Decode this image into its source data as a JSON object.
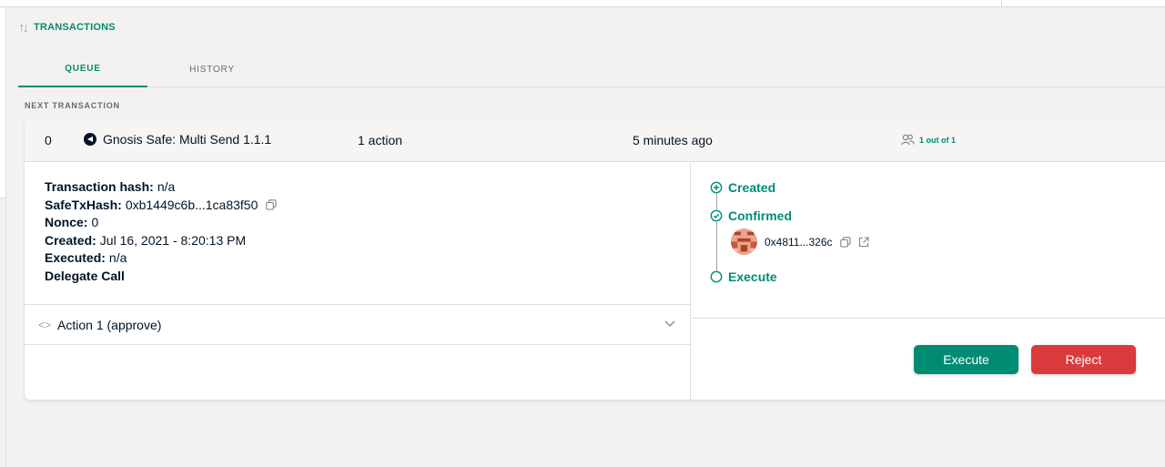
{
  "section": {
    "title": "TRANSACTIONS",
    "icon": "arrows-up-down-icon"
  },
  "tabs": [
    {
      "label": "QUEUE",
      "active": true
    },
    {
      "label": "HISTORY",
      "active": false
    }
  ],
  "next_label": "NEXT TRANSACTION",
  "transaction": {
    "nonce": "0",
    "type": "Gnosis Safe: Multi Send 1.1.1",
    "actions": "1 action",
    "time_ago": "5 minutes ago",
    "confirmations": "1 out of 1"
  },
  "details": {
    "hash_label": "Transaction hash:",
    "hash_value": "n/a",
    "safetx_label": "SafeTxHash:",
    "safetx_value": "0xb1449c6b...1ca83f50",
    "nonce_label": "Nonce:",
    "nonce_value": "0",
    "created_label": "Created:",
    "created_value": "Jul 16, 2021 - 8:20:13 PM",
    "executed_label": "Executed:",
    "executed_value": "n/a",
    "delegate": "Delegate Call"
  },
  "action_row": {
    "label": "Action 1 (approve)"
  },
  "timeline": {
    "created": "Created",
    "confirmed": "Confirmed",
    "owner_address": "0x4811...326c",
    "execute": "Execute"
  },
  "buttons": {
    "execute": "Execute",
    "reject": "Reject"
  },
  "colors": {
    "accent": "#008c73",
    "reject": "#db3a3d",
    "background": "#f4f2f0"
  }
}
